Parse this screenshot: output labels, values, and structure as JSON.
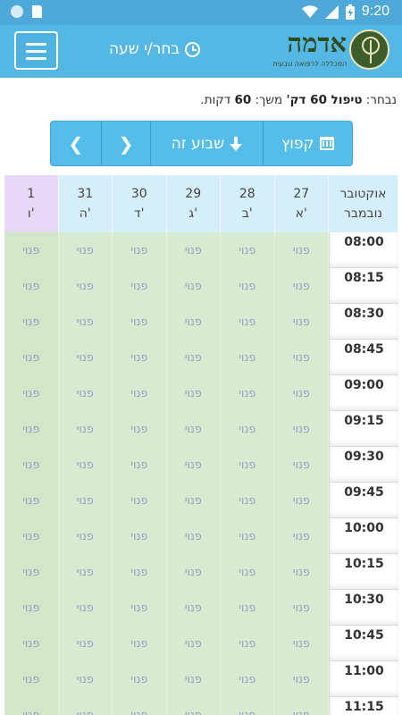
{
  "statusbar": {
    "time": "9:20"
  },
  "header": {
    "title": "בחר/י שעה",
    "logo_word": "אדמה",
    "logo_sub": "המכללה לרפואה טבעית",
    "colors": {
      "bar": "#55b7e4",
      "status": "#4ea9d8"
    }
  },
  "selection": {
    "prefix": "נבחר:",
    "treatment": "טיפול 60 דק'",
    "duration_label": "משך:",
    "duration_value": "60",
    "duration_unit": "דקות."
  },
  "toolbar": {
    "jump_label": "קפוץ",
    "this_week_label": "שבוע זה",
    "next_icon": "chevron-left",
    "prev_icon": "chevron-right"
  },
  "calendar": {
    "month_top": "אוקטובר",
    "month_bottom": "נובמבר",
    "days": [
      {
        "date": "27",
        "day": "א'"
      },
      {
        "date": "28",
        "day": "ב'"
      },
      {
        "date": "29",
        "day": "ג'"
      },
      {
        "date": "30",
        "day": "ד'"
      },
      {
        "date": "31",
        "day": "ה'"
      },
      {
        "date": "1",
        "day": "ו'"
      }
    ],
    "slot_label": "פנוי",
    "times": [
      "08:00",
      "08:15",
      "08:30",
      "08:45",
      "09:00",
      "09:15",
      "09:30",
      "09:45",
      "10:00",
      "10:15",
      "10:30",
      "10:45",
      "11:00",
      "11:15"
    ]
  }
}
